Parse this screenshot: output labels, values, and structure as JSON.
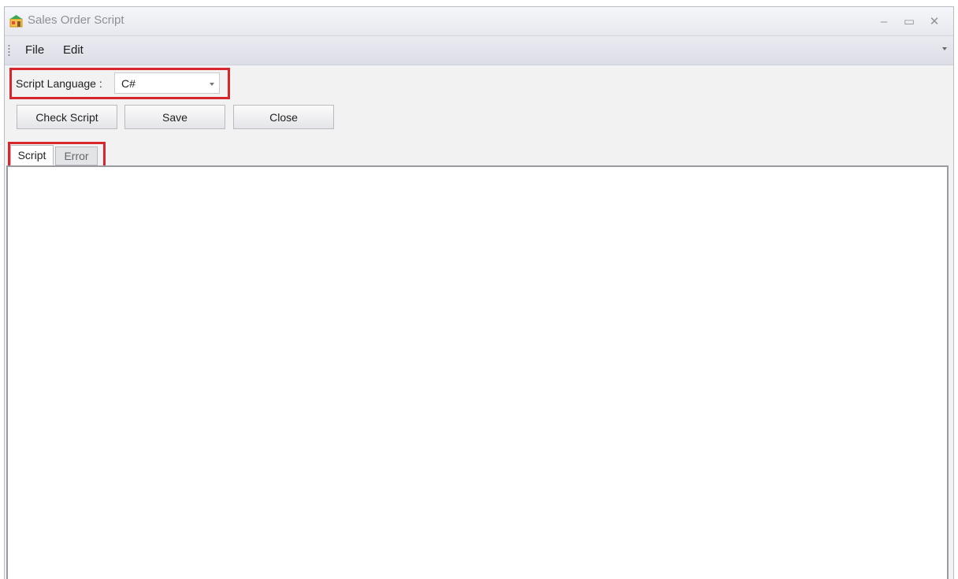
{
  "window": {
    "title": "Sales Order Script",
    "controls": {
      "minimize": "–",
      "maximize": "▭",
      "close": "✕"
    }
  },
  "menu": {
    "items": [
      "File",
      "Edit"
    ]
  },
  "toolbar": {
    "language_label": "Script Language :",
    "language_value": "C#",
    "check_script_label": "Check Script",
    "save_label": "Save",
    "close_label": "Close"
  },
  "tabs": {
    "script_label": "Script",
    "error_label": "Error",
    "active": "Script"
  },
  "editor": {
    "content": ""
  },
  "colors": {
    "highlight": "#d8262d",
    "title_text": "#8d9097",
    "menubar": "#e3e4ec"
  },
  "icons": {
    "app": "app-icon",
    "dropdown": "chevron-down-icon"
  }
}
